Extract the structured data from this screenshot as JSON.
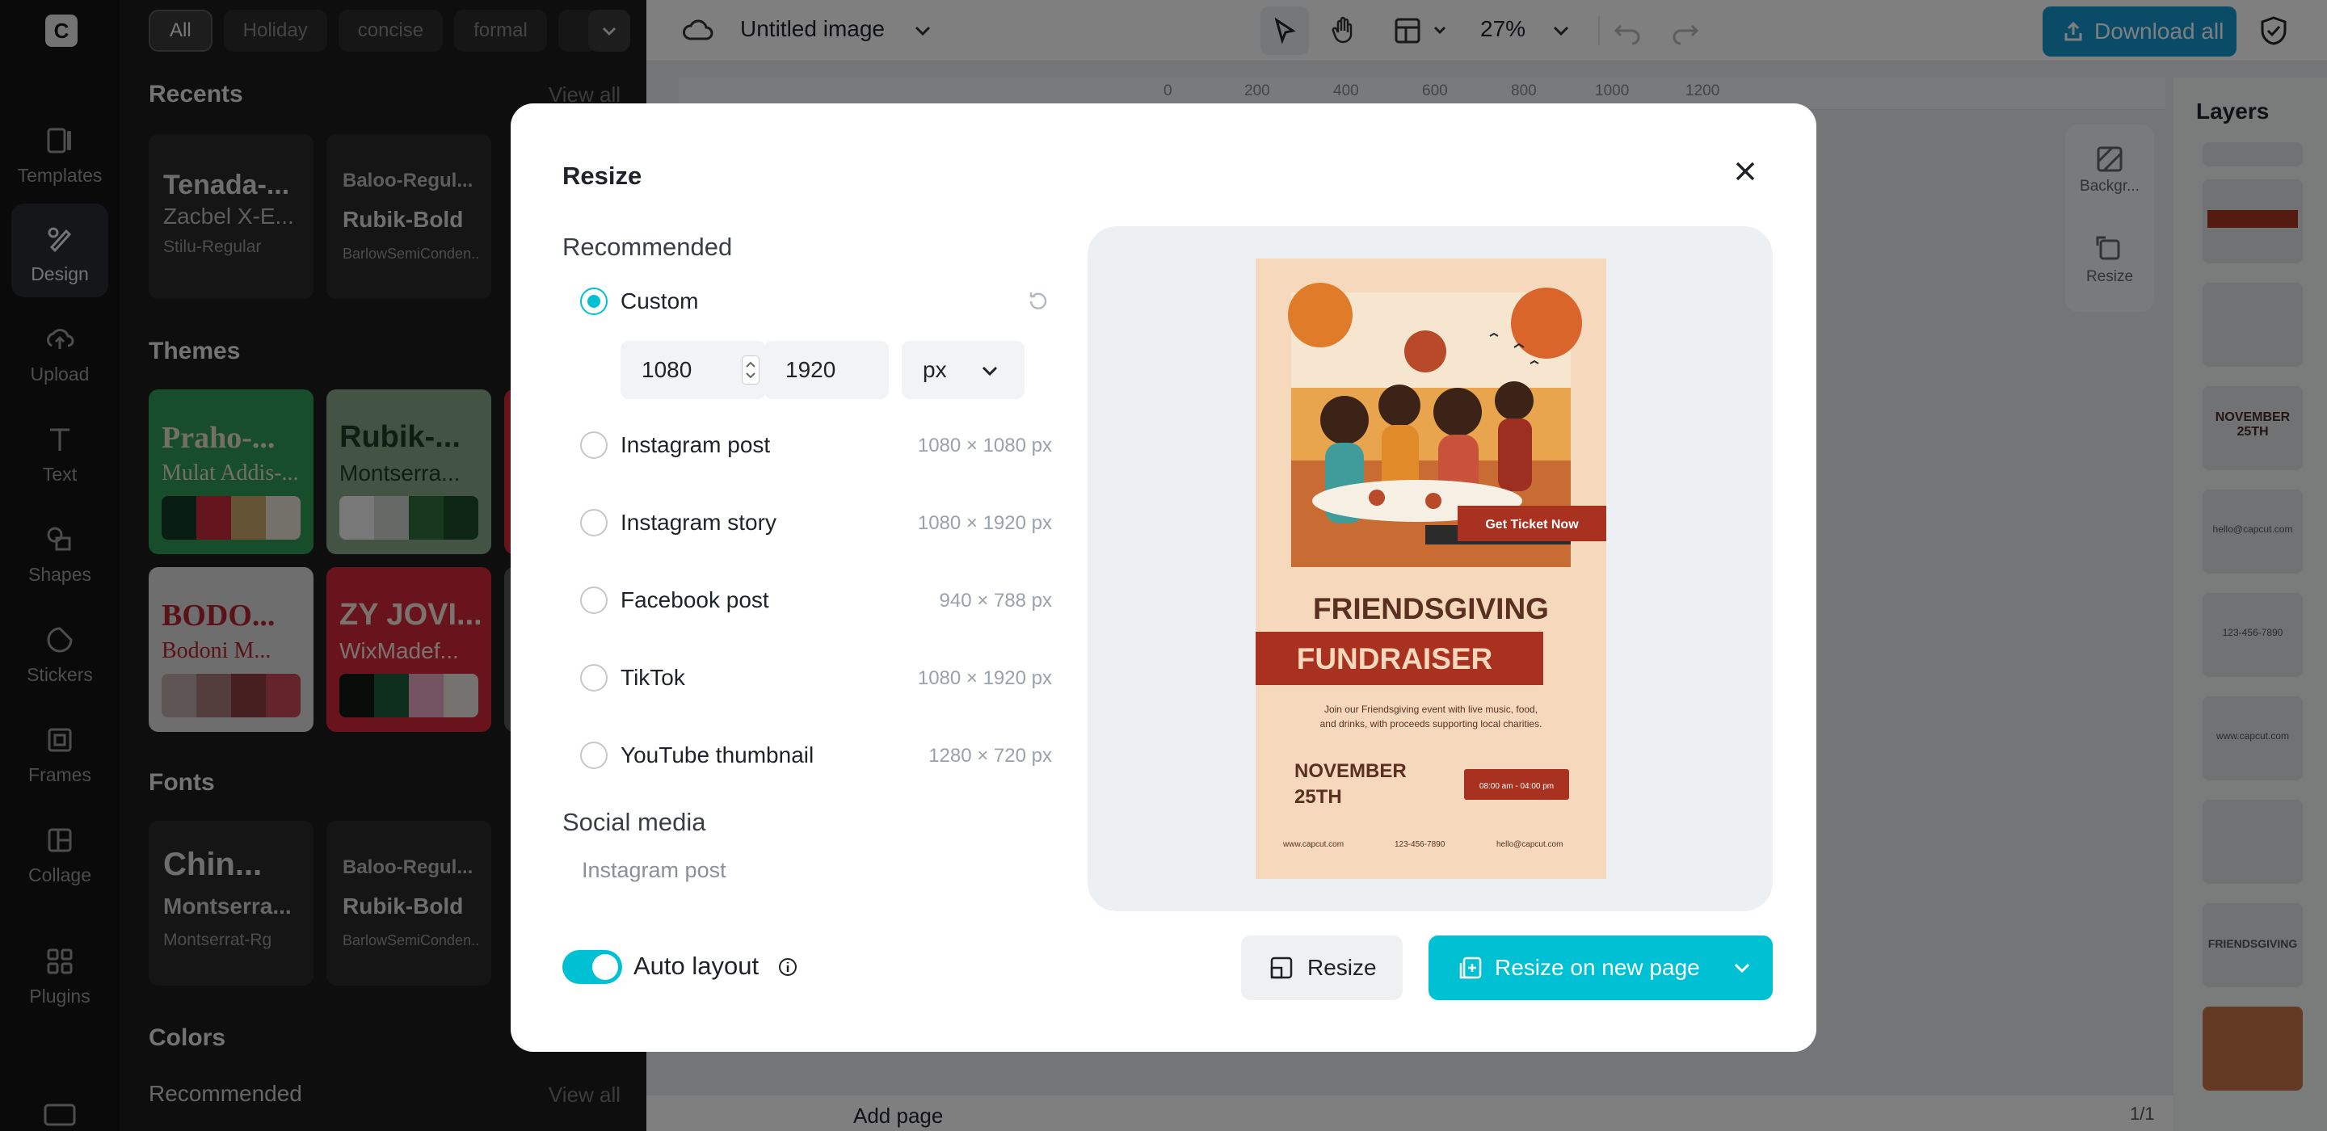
{
  "rail": {
    "items": [
      {
        "label": "Templates",
        "icon": "templates-icon"
      },
      {
        "label": "Design",
        "icon": "design-icon",
        "active": true
      },
      {
        "label": "Upload",
        "icon": "upload-icon"
      },
      {
        "label": "Text",
        "icon": "text-icon"
      },
      {
        "label": "Shapes",
        "icon": "shapes-icon"
      },
      {
        "label": "Stickers",
        "icon": "stickers-icon"
      },
      {
        "label": "Frames",
        "icon": "frames-icon"
      },
      {
        "label": "Collage",
        "icon": "collage-icon"
      },
      {
        "label": "Plugins",
        "icon": "plugins-icon"
      }
    ]
  },
  "panel": {
    "chips": [
      "All",
      "Holiday",
      "concise",
      "formal"
    ],
    "recents": {
      "title": "Recents",
      "view_all": "View all",
      "cards": [
        {
          "l1": "Tenada-...",
          "l2": "Zacbel X-E...",
          "l3": "Stilu-Regular"
        },
        {
          "l1": "Baloo-Regul...",
          "l2": "Rubik-Bold",
          "l3": "BarlowSemiConden..."
        }
      ]
    },
    "themes": {
      "title": "Themes",
      "cards": [
        {
          "l1": "Praho-...",
          "l2": "Mulat Addis-...",
          "bg": "#2f9a55",
          "swatches": [
            "#0e3b24",
            "#c8283a",
            "#c9a86b",
            "#e8e3d6"
          ]
        },
        {
          "l1": "Rubik-...",
          "l2": "Montserra...",
          "bg": "#87a88a",
          "swatches": [
            "#f0f0f0",
            "#cfd2cc",
            "#2f6e3d",
            "#1d4d2a"
          ]
        },
        {
          "l1": "BODO...",
          "l2": "Bodoni M...",
          "bg": "#dcdcdc",
          "swatches": [
            "#bfa9a9",
            "#a77a7a",
            "#8e3f42",
            "#c74a56"
          ]
        },
        {
          "l1": "ZY JOVI...",
          "l2": "WixMadef...",
          "bg": "#d3263a",
          "swatches": [
            "#101a12",
            "#1c5e3b",
            "#e7a9c0",
            "#e8e3de"
          ]
        }
      ]
    },
    "fonts": {
      "title": "Fonts",
      "cards": [
        {
          "l1": "Chin...",
          "l2": "Montserra...",
          "l3": "Montserrat-Rg"
        },
        {
          "l1": "Baloo-Regul...",
          "l2": "Rubik-Bold",
          "l3": "BarlowSemiConden..."
        }
      ]
    },
    "colors": {
      "title": "Colors",
      "sub": "Recommended",
      "view_all": "View all"
    }
  },
  "topbar": {
    "doc_title": "Untitled image",
    "zoom": "27%",
    "download_label": "Download all"
  },
  "ruler": [
    "0",
    "200",
    "400",
    "600",
    "800",
    "1000",
    "1200"
  ],
  "dock": [
    "Backgr...",
    "Resize"
  ],
  "layers": {
    "title": "Layers",
    "thumbs": [
      "",
      "",
      "",
      "NOVEMBER 25TH",
      "hello@capcut.com",
      "123-456-7890",
      "www.capcut.com",
      "",
      "FRIENDSGIVING",
      ""
    ]
  },
  "bottom": {
    "add_page": "Add page",
    "pages": "1/1"
  },
  "modal": {
    "title": "Resize",
    "recommended": "Recommended",
    "custom_label": "Custom",
    "width": "1080",
    "height": "1920",
    "unit": "px",
    "options": [
      {
        "label": "Instagram post",
        "size": "1080 × 1080 px"
      },
      {
        "label": "Instagram story",
        "size": "1080 × 1920 px"
      },
      {
        "label": "Facebook post",
        "size": "940 × 788 px"
      },
      {
        "label": "TikTok",
        "size": "1080 × 1920 px"
      },
      {
        "label": "YouTube thumbnail",
        "size": "1280 × 720 px"
      }
    ],
    "social_media": "Social media",
    "social_first": "Instagram post",
    "auto_layout": "Auto layout",
    "resize_btn": "Resize",
    "resize_new_btn": "Resize on new page"
  },
  "poster": {
    "cta": "Get Ticket Now",
    "title1": "FRIENDSGIVING",
    "title2": "FUNDRAISER",
    "body1": "Join our Friendsgiving event with live music, food,",
    "body2": "and drinks, with proceeds supporting local charities.",
    "date1": "NOVEMBER",
    "date2": "25TH",
    "time": "08:00 am - 04:00 pm",
    "web": "www.capcut.com",
    "phone": "123-456-7890",
    "email": "hello@capcut.com"
  },
  "colors": {
    "accent": "#00c1d4",
    "download": "#1597d0",
    "poster_bg": "#f6d8bd",
    "poster_red": "#a8321f"
  }
}
